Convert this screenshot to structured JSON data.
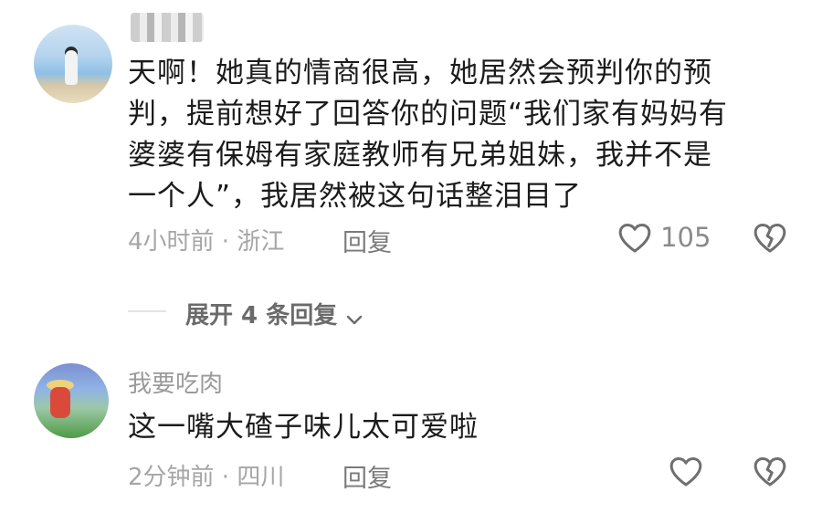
{
  "comments": [
    {
      "username": "",
      "text": "天啊！她真的情商很高，她居然会预判你的预判，提前想好了回答你的问题“我们家有妈妈有婆婆有保姆有家庭教师有兄弟姐妹，我并不是一个人”，我居然被这句话整泪目了",
      "lines": [
        "天啊！她真的情商很高，她居然会预判你的预",
        "判，提前想好了回答你的问题“我们家有妈妈有",
        "婆婆有保姆有家庭教师有兄弟姐妹，我并不是",
        "一个人”，我居然被这句话整泪目了"
      ],
      "time": "4小时前",
      "location": "浙江",
      "meta": "4小时前 · 浙江",
      "reply_label": "回复",
      "like_count": "105",
      "expand_label": "展开 4 条回复"
    },
    {
      "username": "我要吃肉",
      "text": "这一嘴大碴子味儿太可爱啦",
      "time": "2分钟前",
      "location": "四川",
      "meta": "2分钟前 · 四川",
      "reply_label": "回复",
      "like_count": ""
    }
  ],
  "icons": {
    "like": "heart-outline-icon",
    "dislike": "broken-heart-icon",
    "expand": "chevron-down-icon"
  },
  "colors": {
    "text": "#1b1b1b",
    "meta": "#a6a6a6",
    "icon": "#6f6f6f"
  }
}
